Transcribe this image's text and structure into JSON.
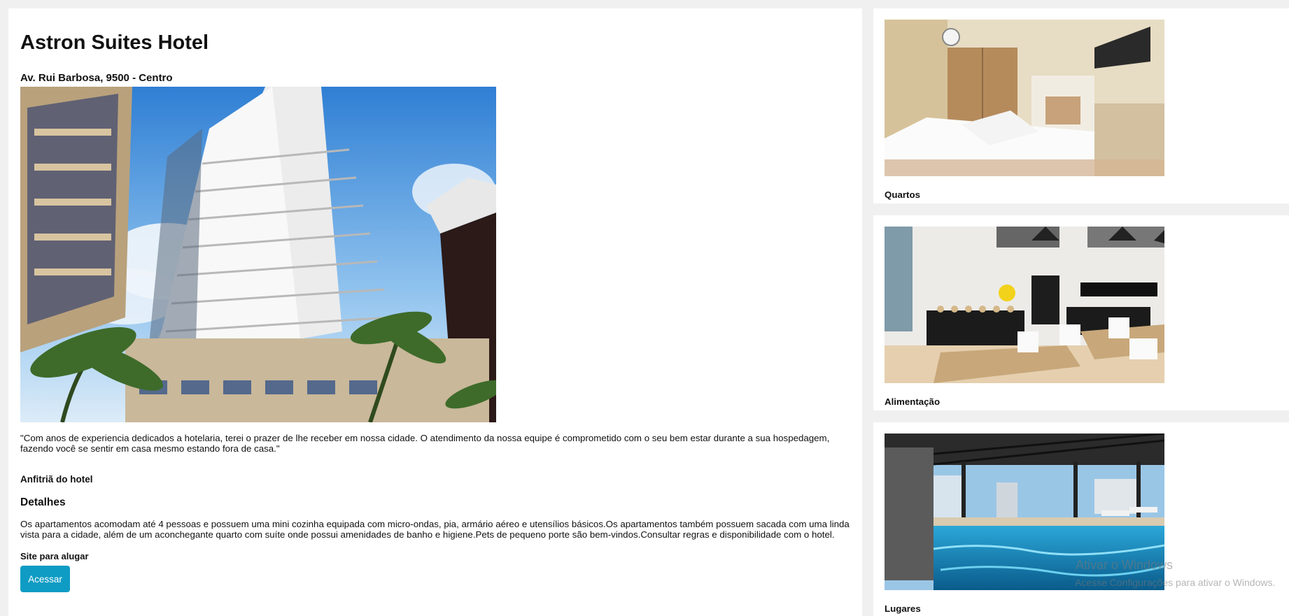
{
  "hotel": {
    "name": "Astron Suites Hotel",
    "address": "Av. Rui Barbosa, 9500 - Centro",
    "quote": "\"Com anos de experiencia dedicados a hotelaria, terei o prazer de lhe receber em nossa cidade. O atendimento da nossa equipe é comprometido com o seu bem estar durante a sua hospedagem, fazendo você se sentir em casa mesmo estando fora de casa.\"",
    "host": "Anfitriã do hotel",
    "details_title": "Detalhes",
    "details_text": "Os apartamentos acomodam até 4 pessoas e possuem uma mini cozinha equipada com micro-ondas, pia, armário aéreo e utensílios básicos.Os apartamentos também possuem sacada com uma linda vista para a cidade, além de um aconchegante quarto com suíte onde possui amenidades de banho e higiene.Pets de pequeno porte são bem-vindos.Consultar regras e disponibilidade com o hotel.",
    "site_label": "Site para alugar",
    "access_button": "Acessar"
  },
  "gallery": [
    {
      "label": "Quartos"
    },
    {
      "label": "Alimentação"
    },
    {
      "label": "Lugares"
    }
  ],
  "watermark": {
    "line1": "Ativar o Windows",
    "line2": "Acesse Configurações para ativar o Windows."
  },
  "colors": {
    "accent": "#0e9cc4",
    "background": "#f0f0f0"
  }
}
